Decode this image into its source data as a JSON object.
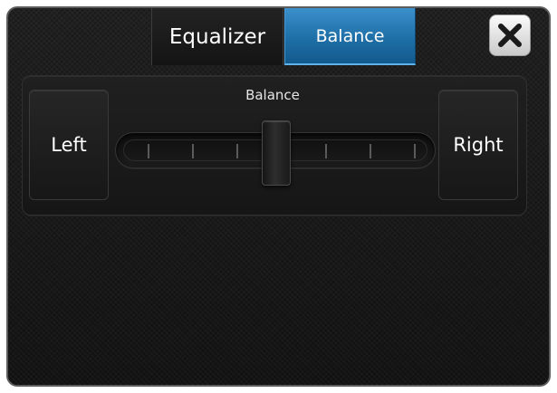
{
  "tabs": [
    {
      "label": "Equalizer",
      "active": false
    },
    {
      "label": "Balance",
      "active": true
    }
  ],
  "close_button": {
    "icon": "close-icon"
  },
  "balance": {
    "label": "Balance",
    "left_label": "Left",
    "right_label": "Right",
    "value_fraction": 0.5
  },
  "colors": {
    "active_tab": "#2a82c0",
    "background": "#191919",
    "text": "#ffffff"
  }
}
